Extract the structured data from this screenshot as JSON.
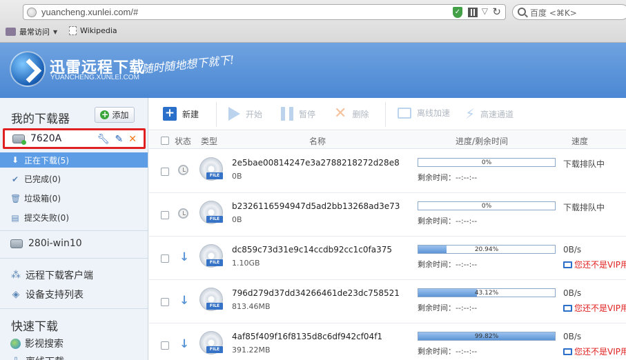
{
  "browser": {
    "url": "yuancheng.xunlei.com/#",
    "search_placeholder": "百度 <⌘K>",
    "bookmarks": [
      {
        "label": "最常访问"
      },
      {
        "label": "Wikipedia"
      }
    ]
  },
  "brand": {
    "title": "迅雷远程下载",
    "domain": "YUANCHENG.XUNLEI.COM",
    "slogan": "随时随地想下就下!"
  },
  "sidebar": {
    "heading": "我的下载器",
    "add_label": "添加",
    "devices": [
      {
        "name": "7620A",
        "selected": true
      },
      {
        "name": "280i-win10",
        "selected": false
      }
    ],
    "categories": [
      {
        "label": "正在下载(5)",
        "icon": "arrow-down-icon"
      },
      {
        "label": "已完成(0)",
        "icon": "check-icon"
      },
      {
        "label": "垃圾箱(0)",
        "icon": "trash-icon"
      },
      {
        "label": "提交失败(0)",
        "icon": "document-icon"
      }
    ],
    "links": [
      {
        "label": "远程下载客户端",
        "icon": "client-icon"
      },
      {
        "label": "设备支持列表",
        "icon": "list-icon"
      }
    ],
    "quick_heading": "快速下载",
    "quick_links": [
      {
        "label": "影视搜索",
        "icon": "globe-icon"
      },
      {
        "label": "离线下载"
      }
    ]
  },
  "toolbar": {
    "new": "新建",
    "start": "开始",
    "pause": "暂停",
    "delete": "删除",
    "offline": "离线加速",
    "fast": "高速通道"
  },
  "table": {
    "headers": {
      "status": "状态",
      "type": "类型",
      "name": "名称",
      "progress": "进度/剩余时间",
      "speed": "速度"
    },
    "remain_prefix": "剩余时间：",
    "rows": [
      {
        "name": "2e5bae00814247e3a2788218272d28e8",
        "size": "0B",
        "progress": 0.0,
        "progress_label": "0%",
        "remain": "--:--:--",
        "speed": "下载排队中",
        "vip": "",
        "state": "queued"
      },
      {
        "name": "b2326116594947d5ad2bb13268ad3e73",
        "size": "0B",
        "progress": 0.0,
        "progress_label": "0%",
        "remain": "--:--:--",
        "speed": "下载排队中",
        "vip": "",
        "state": "queued"
      },
      {
        "name": "dc859c73d31e9c14ccdb92cc1c0fa375",
        "size": "1.10GB",
        "progress": 20.94,
        "progress_label": "20.94%",
        "remain": "--:--:--",
        "speed": "0B/s",
        "vip": "您还不是VIP用",
        "state": "downloading"
      },
      {
        "name": "796d279d37dd34266461de23dc758521",
        "size": "813.46MB",
        "progress": 43.12,
        "progress_label": "43.12%",
        "remain": "--:--:--",
        "speed": "0B/s",
        "vip": "您还不是VIP用",
        "state": "downloading"
      },
      {
        "name": "4af85f409f16f8135d8c6df942cf04f1",
        "size": "391.22MB",
        "progress": 99.82,
        "progress_label": "99.82%",
        "remain": "--:--:--",
        "speed": "0B/s",
        "vip": "您还不是VIP用",
        "state": "downloading"
      }
    ]
  }
}
